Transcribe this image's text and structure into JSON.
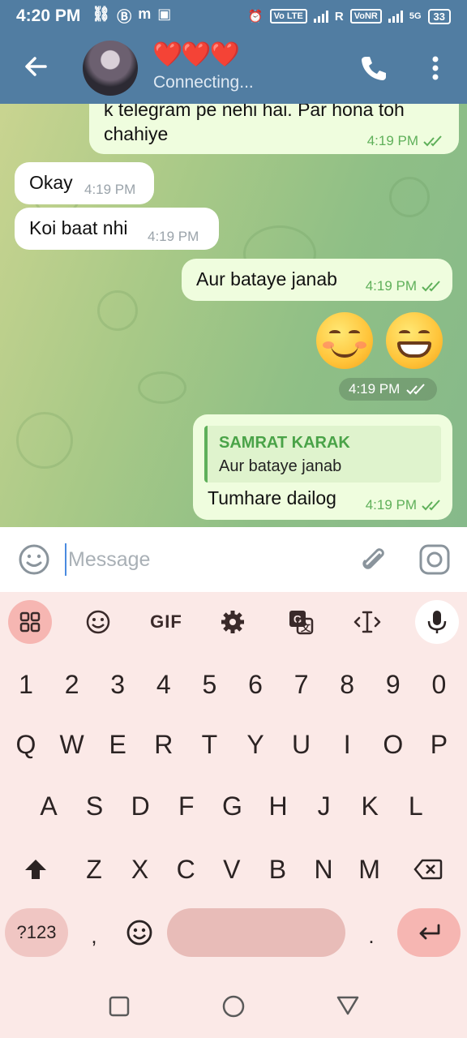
{
  "status_bar": {
    "time": "4:20 PM",
    "left_icons": [
      "link-icon",
      "bluetooth-b-icon",
      "m-icon",
      "m-badge-icon"
    ],
    "volte_label": "Vo LTE",
    "signal_label": "R",
    "vonr_label": "VoNR",
    "network_label": "5G",
    "battery": "33"
  },
  "header": {
    "title": "❤️❤️❤️",
    "subtitle": "Connecting..."
  },
  "messages": [
    {
      "direction": "out",
      "text": "k telegram pe nehi hai. Par hona toh chahiye",
      "time": "4:19 PM",
      "status": "read"
    },
    {
      "direction": "in",
      "text": "Okay",
      "time": "4:19 PM"
    },
    {
      "direction": "in",
      "text": "Koi baat nhi",
      "time": "4:19 PM"
    },
    {
      "direction": "out",
      "text": "Aur bataye janab",
      "time": "4:19 PM",
      "status": "read"
    },
    {
      "direction": "out",
      "emoji": [
        "smiling-face-with-smiling-eyes",
        "grinning-face-with-smiling-eyes"
      ],
      "time": "4:19 PM",
      "status": "read"
    },
    {
      "direction": "out",
      "reply_to": {
        "sender": "SAMRAT KARAK",
        "text": "Aur bataye janab"
      },
      "text": "Tumhare dailog",
      "time": "4:19 PM",
      "status": "read"
    }
  ],
  "input": {
    "placeholder": "Message"
  },
  "keyboard": {
    "toolbar": [
      "apps-grid-icon",
      "emoji-icon",
      "GIF",
      "settings-gear-icon",
      "translate-icon",
      "text-cursor-icon",
      "mic-icon"
    ],
    "gif_label": "GIF",
    "rows": [
      [
        "1",
        "2",
        "3",
        "4",
        "5",
        "6",
        "7",
        "8",
        "9",
        "0"
      ],
      [
        "Q",
        "W",
        "E",
        "R",
        "T",
        "Y",
        "U",
        "I",
        "O",
        "P"
      ],
      [
        "A",
        "S",
        "D",
        "F",
        "G",
        "H",
        "J",
        "K",
        "L"
      ],
      [
        "Z",
        "X",
        "C",
        "V",
        "B",
        "N",
        "M"
      ]
    ],
    "symbols_label": "?123",
    "comma_label": ",",
    "period_label": "."
  },
  "colors": {
    "header": "#517da2",
    "bubble_out": "#effdde",
    "bubble_in": "#ffffff",
    "accent_green": "#5fb05a",
    "keyboard_bg": "#fbe9e7"
  }
}
